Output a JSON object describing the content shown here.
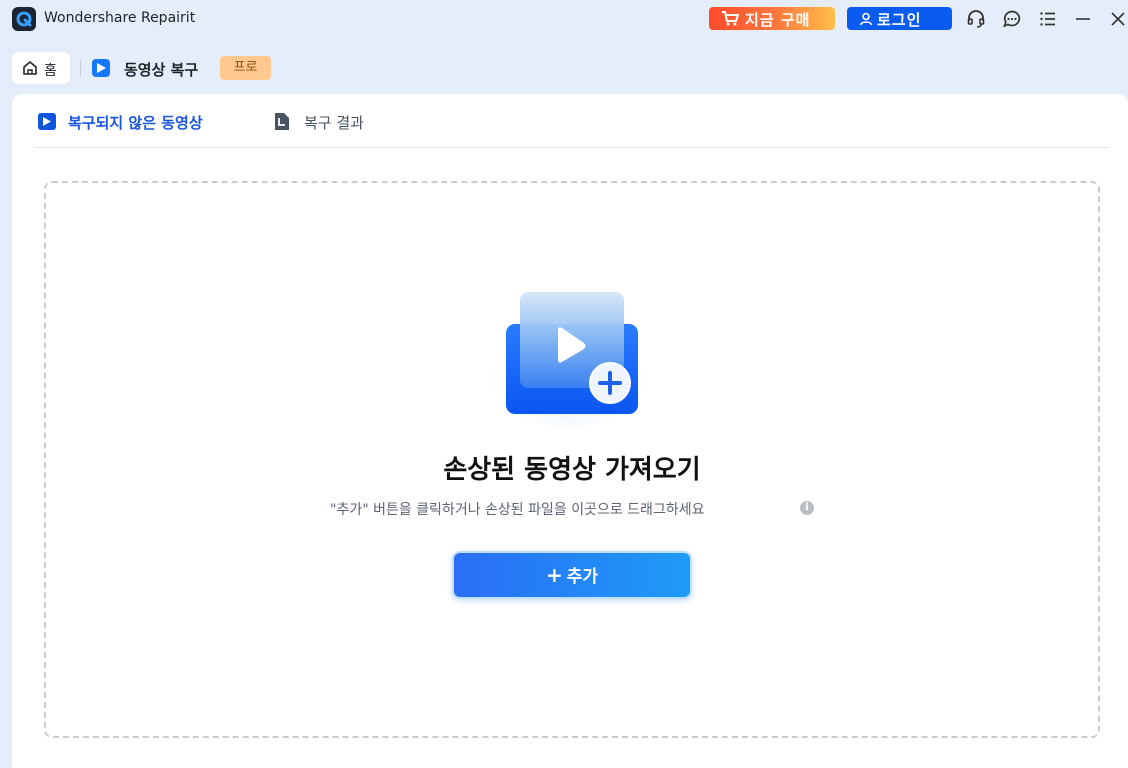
{
  "titlebar": {
    "app_name": "Wondershare Repairit",
    "buy_label": "지금 구매",
    "login_label": "로그인",
    "icons": [
      "headset-icon",
      "chat-icon",
      "menu-icon",
      "minimize-icon",
      "close-icon"
    ]
  },
  "tabs": {
    "home_label": "홈",
    "video_repair_label": "동영상 복구",
    "pro_badge": "프로"
  },
  "subtabs": {
    "unrepaired": "복구되지 않은 동영상",
    "results": "복구 결과"
  },
  "dropzone": {
    "title": "손상된 동영상 가져오기",
    "subtitle": "\"추가\" 버튼을 클릭하거나 손상된 파일을 이곳으로 드래그하세요",
    "info_glyph": "i",
    "add_label": "추가",
    "add_plus": "+"
  },
  "colors": {
    "accent": "#1677ff",
    "login": "#0a5cf0",
    "buy_gradient_start": "#ff4b2b",
    "buy_gradient_end": "#ffbf4a",
    "pro_badge_bg": "#ffc98f",
    "background": "#e4edf9"
  }
}
